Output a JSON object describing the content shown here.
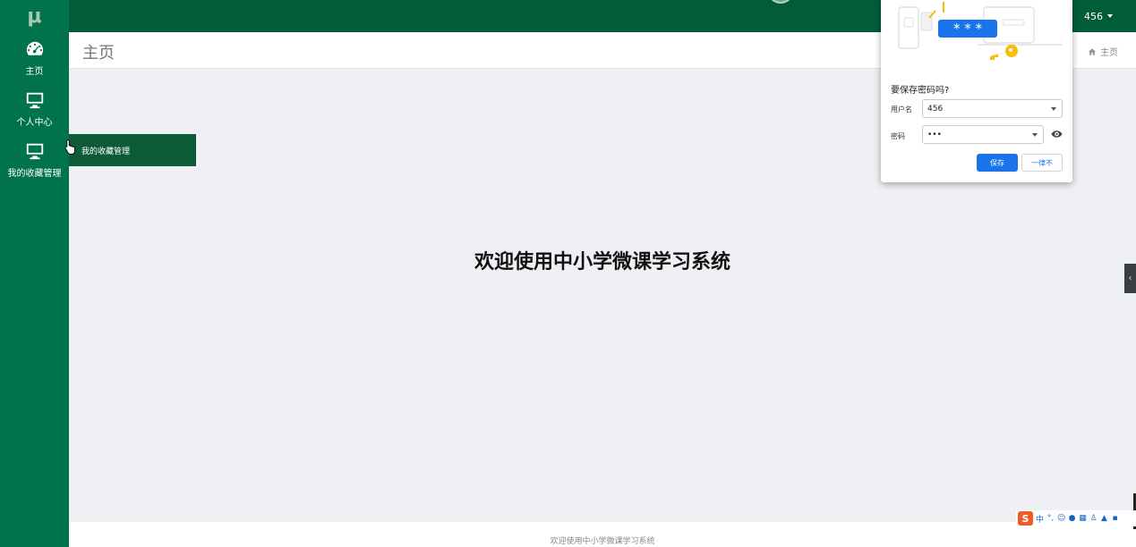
{
  "app": {
    "logo": "μ"
  },
  "sidebar": {
    "items": [
      {
        "label": "主页",
        "icon": "dashboard-icon"
      },
      {
        "label": "个人中心",
        "icon": "monitor-icon"
      },
      {
        "label": "我的收藏管理",
        "icon": "monitor-icon"
      }
    ]
  },
  "topbar": {
    "user": "456"
  },
  "header": {
    "title": "主页",
    "breadcrumb": "主页"
  },
  "main": {
    "welcome": "欢迎使用中小学微课学习系统"
  },
  "footer": {
    "text": "欢迎使用中小学微课学习系统"
  },
  "tooltip": {
    "text": "我的收藏管理"
  },
  "password_dialog": {
    "question": "要保存密码吗?",
    "username_label": "用户名",
    "username_value": "456",
    "password_label": "密码",
    "password_value": "•••",
    "save_label": "保存",
    "never_label": "一律不",
    "masked_text": "* * *"
  },
  "ime": {
    "mode": "中",
    "punct": "°,"
  },
  "colors": {
    "sidebar": "#00734a",
    "topbar": "#005c39",
    "accent": "#1a73e8"
  }
}
